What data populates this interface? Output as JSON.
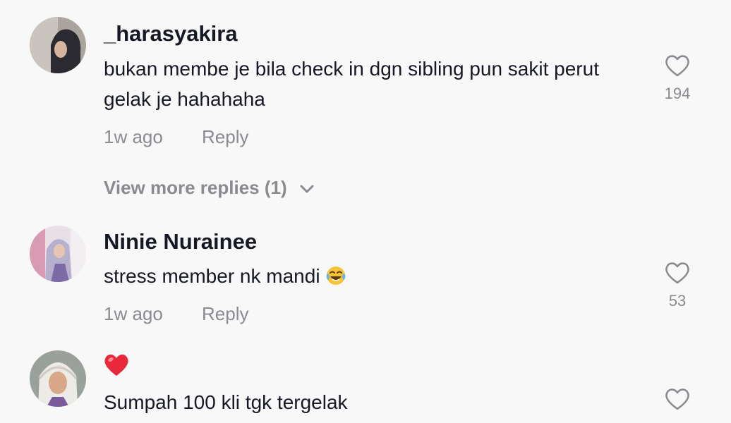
{
  "comments": [
    {
      "username": "_harasyakira",
      "text": "bukan membe je bila check in dgn sibling pun sakit perut gelak je hahahaha",
      "time": "1w ago",
      "reply_label": "Reply",
      "likes": "194",
      "view_more_label": "View more replies (1)"
    },
    {
      "username": "Ninie Nurainee",
      "text": "stress member nk mandi",
      "emoji": "face-with-tears-of-joy",
      "time": "1w ago",
      "reply_label": "Reply",
      "likes": "53"
    },
    {
      "username": "",
      "emoji": "red-heart",
      "text": "Sumpah 100 kli tgk tergelak"
    }
  ],
  "colors": {
    "background": "#f8f8f8",
    "username": "#161823",
    "secondary_text": "#8a8b91"
  }
}
